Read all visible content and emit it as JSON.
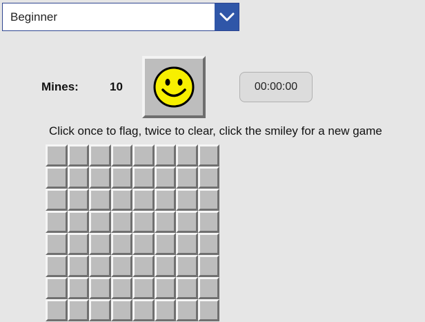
{
  "difficulty": {
    "selected": "Beginner",
    "arrow_icon": "chevron-down-icon",
    "accent_color": "#2f56a8"
  },
  "status": {
    "mines_label": "Mines:",
    "mines_count": "10",
    "smiley_icon": "smiley-face-icon",
    "timer": "00:00:00"
  },
  "instructions": "Click once to flag, twice to clear, click the smiley for a new game",
  "board": {
    "rows": 8,
    "cols": 8,
    "cell_state": "unrevealed",
    "cell_color": "#bdbdbd"
  }
}
